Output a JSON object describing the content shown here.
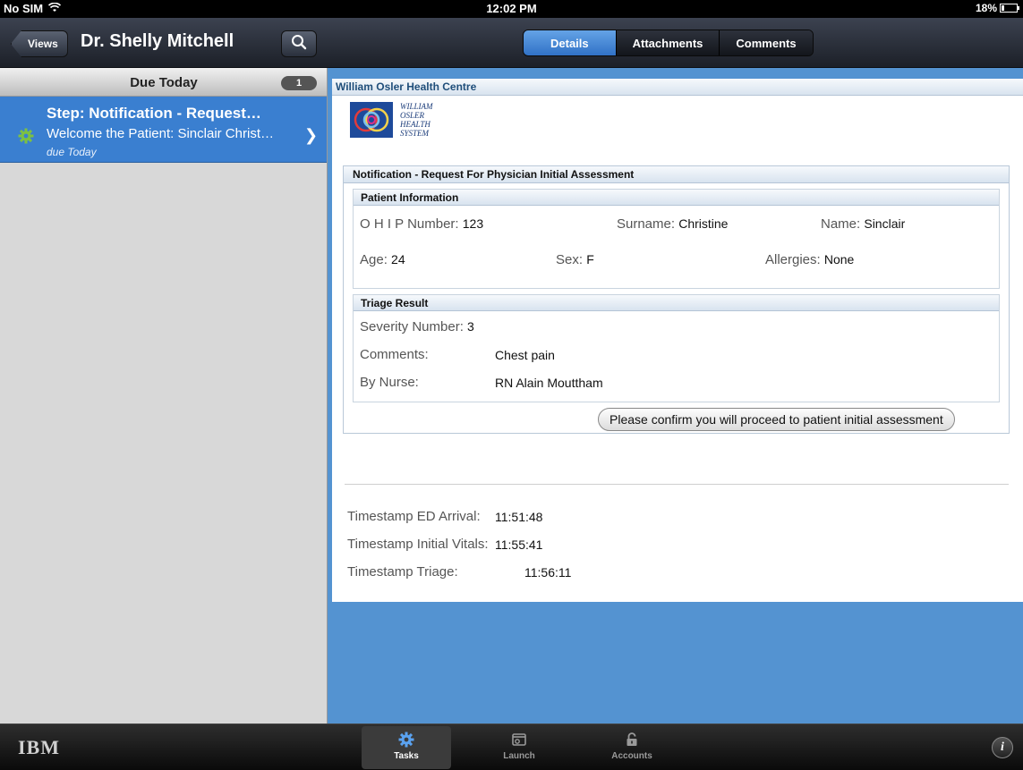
{
  "status_bar": {
    "carrier": "No SIM",
    "time": "12:02 PM",
    "battery": "18%",
    "battery_level": 0.18
  },
  "left_nav": {
    "views_label": "Views",
    "title": "Dr. Shelly Mitchell"
  },
  "task_list": {
    "section_title": "Due Today",
    "section_count": "1",
    "items": [
      {
        "title": "Step: Notification - Request…",
        "subtitle": "Welcome the Patient: Sinclair Christ…",
        "due": "due Today"
      }
    ]
  },
  "tabs": {
    "items": [
      {
        "label": "Details",
        "active": true
      },
      {
        "label": "Attachments",
        "active": false
      },
      {
        "label": "Comments",
        "active": false
      }
    ]
  },
  "document": {
    "org_name": "William Osler Health Centre",
    "logo_lines": [
      "WILLIAM",
      "OSLER",
      "HEALTH",
      "SYSTEM"
    ],
    "form_title": "Notification - Request For Physician Initial Assessment",
    "patient_info": {
      "title": "Patient Information",
      "ohip_label": "O H I P Number:",
      "ohip_value": "123",
      "surname_label": "Surname:",
      "surname_value": "Christine",
      "name_label": "Name:",
      "name_value": "Sinclair",
      "age_label": "Age:",
      "age_value": "24",
      "sex_label": "Sex:",
      "sex_value": "F",
      "allergies_label": "Allergies:",
      "allergies_value": "None"
    },
    "triage": {
      "title": "Triage Result",
      "severity_label": "Severity Number:",
      "severity_value": "3",
      "comments_label": "Comments:",
      "comments_value": "Chest pain",
      "nurse_label": "By Nurse:",
      "nurse_value": "RN Alain Mouttham"
    },
    "confirm_label": "Please confirm you will proceed to patient initial assessment",
    "timestamps": [
      {
        "label": "Timestamp ED Arrival:",
        "value": "11:51:48"
      },
      {
        "label": "Timestamp Initial Vitals:",
        "value": "11:55:41"
      },
      {
        "label": "Timestamp Triage:",
        "value": "11:56:11"
      }
    ]
  },
  "tab_bar": {
    "brand": "IBM",
    "items": [
      {
        "label": "Tasks",
        "icon": "gear-icon",
        "active": true
      },
      {
        "label": "Launch",
        "icon": "launch-icon",
        "active": false
      },
      {
        "label": "Accounts",
        "icon": "lock-icon",
        "active": false
      }
    ],
    "info": "i"
  },
  "colors": {
    "accent": "#3a7fd0",
    "panel_bg": "#5493d1",
    "title_text": "#1f4e7a"
  }
}
